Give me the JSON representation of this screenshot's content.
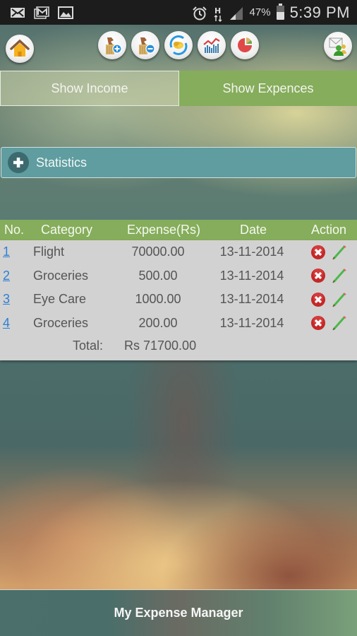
{
  "status_bar": {
    "left_icons": [
      "email-icon",
      "gmail-icon",
      "gallery-icon"
    ],
    "right_icons": [
      "alarm-icon",
      "hspa-data-icon",
      "signal-icon"
    ],
    "battery_percent": "47%",
    "time": "5:39 PM"
  },
  "toolbar": {
    "buttons": [
      {
        "name": "home",
        "icon": "home-icon"
      },
      {
        "name": "add-income",
        "icon": "add-money-icon"
      },
      {
        "name": "add-expense",
        "icon": "remove-money-icon"
      },
      {
        "name": "convert",
        "icon": "currency-exchange-icon"
      },
      {
        "name": "reports",
        "icon": "line-chart-icon"
      },
      {
        "name": "pie-chart",
        "icon": "pie-chart-icon"
      },
      {
        "name": "contact",
        "icon": "mail-user-icon"
      }
    ]
  },
  "tabs": {
    "income_label": "Show Income",
    "expense_label": "Show Expences",
    "active": "expense"
  },
  "statistics": {
    "label": "Statistics"
  },
  "table": {
    "headers": {
      "no": "No.",
      "category": "Category",
      "expense": "Expense(Rs)",
      "date": "Date",
      "action": "Action"
    },
    "rows": [
      {
        "no": "1",
        "category": "Flight",
        "expense": "70000.00",
        "date": "13-11-2014"
      },
      {
        "no": "2",
        "category": "Groceries",
        "expense": "500.00",
        "date": "13-11-2014"
      },
      {
        "no": "3",
        "category": "Eye Care",
        "expense": "1000.00",
        "date": "13-11-2014"
      },
      {
        "no": "4",
        "category": "Groceries",
        "expense": "200.00",
        "date": "13-11-2014"
      }
    ],
    "total_label": "Total:",
    "total_value": "Rs 71700.00"
  },
  "footer": {
    "app_name": "My Expense Manager"
  },
  "colors": {
    "accent_green": "#85ad5b",
    "statistics_teal": "#5f9da0",
    "link_blue": "#2d7fd4",
    "delete_red": "#cc2a2a",
    "table_bg": "#d2d2d2"
  }
}
